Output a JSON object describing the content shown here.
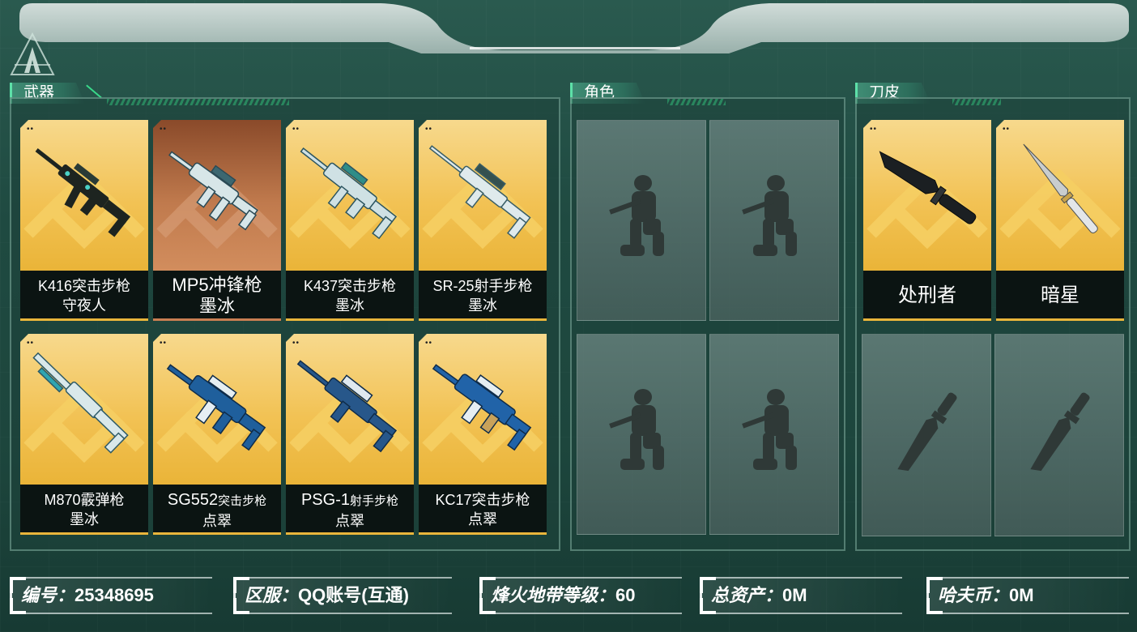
{
  "sections": {
    "weapons": "武器",
    "characters": "角色",
    "knife_skins": "刀皮"
  },
  "weapons": [
    {
      "line1": "K416突击步枪",
      "line2": "守夜人",
      "rarity": "gold"
    },
    {
      "line1": "MP5冲锋枪",
      "line2": "墨冰",
      "rarity": "bronze"
    },
    {
      "line1": "K437突击步枪",
      "line2": "墨冰",
      "rarity": "gold"
    },
    {
      "line1": "SR-25射手步枪",
      "line2": "墨冰",
      "rarity": "gold"
    },
    {
      "line1": "M870霰弹枪",
      "line2": "墨冰",
      "rarity": "gold"
    },
    {
      "line1a": "SG552",
      "line1b": "突击步枪",
      "line2": "点翠",
      "rarity": "gold"
    },
    {
      "line1a": "PSG-1",
      "line1b": "射手步枪",
      "line2": "点翠",
      "rarity": "gold"
    },
    {
      "line1": "KC17突击步枪",
      "line2": "点翠",
      "rarity": "gold"
    }
  ],
  "knives": [
    {
      "name": "处刑者",
      "rarity": "gold"
    },
    {
      "name": "暗星",
      "rarity": "gold"
    }
  ],
  "card_dots": "••",
  "info": {
    "id_label": "编号：",
    "id_value": "25348695",
    "server_label": "区服：",
    "server_value": "QQ账号(互通)",
    "level_label": "烽火地带等级：",
    "level_value": "60",
    "assets_label": "总资产：",
    "assets_value": "0M",
    "coin_label": "哈夫币：",
    "coin_value": "0M"
  },
  "colors": {
    "accent_green": "#39d98a",
    "card_gold": "#f2c254",
    "card_bronze": "#c07a4d",
    "label_bg": "#0b1412"
  }
}
